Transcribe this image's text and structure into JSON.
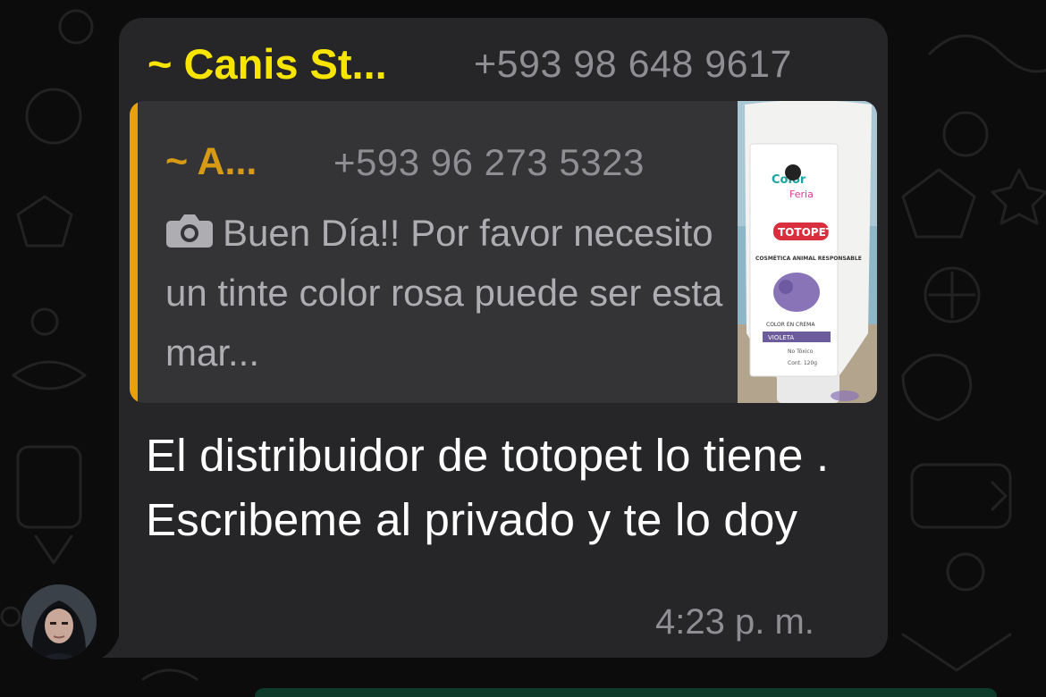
{
  "chat": {
    "message": {
      "sender_name": "~ Canis St...",
      "sender_phone": "+593 98 648 9617",
      "quoted": {
        "author_name": "~ A...",
        "author_phone": "+593 96 273 5323",
        "media_icon": "camera-icon",
        "text": "Buen Día!! Por favor necesito un tinte color rosa puede ser esta mar...",
        "thumbnail": {
          "label_top": "Color",
          "label_fiesta": "Feria",
          "brand": "TOTOPET",
          "subtitle": "COSMÉTICA ANIMAL RESPONSABLE",
          "product": "COLOR EN CREMA",
          "shade": "VIOLETA",
          "note": "No Tóxico",
          "content": "Cont. 120g"
        }
      },
      "text": "El distribuidor de totopet lo tiene . Escribeme al privado y te lo doy",
      "time": "4:23 p. m."
    }
  },
  "colors": {
    "bubble": "#262628",
    "quote_bg": "#343436",
    "sender_name": "#f7e500",
    "quote_bar": "#e8a10a",
    "quote_name": "#d69a14",
    "muted": "#8e8e93"
  }
}
